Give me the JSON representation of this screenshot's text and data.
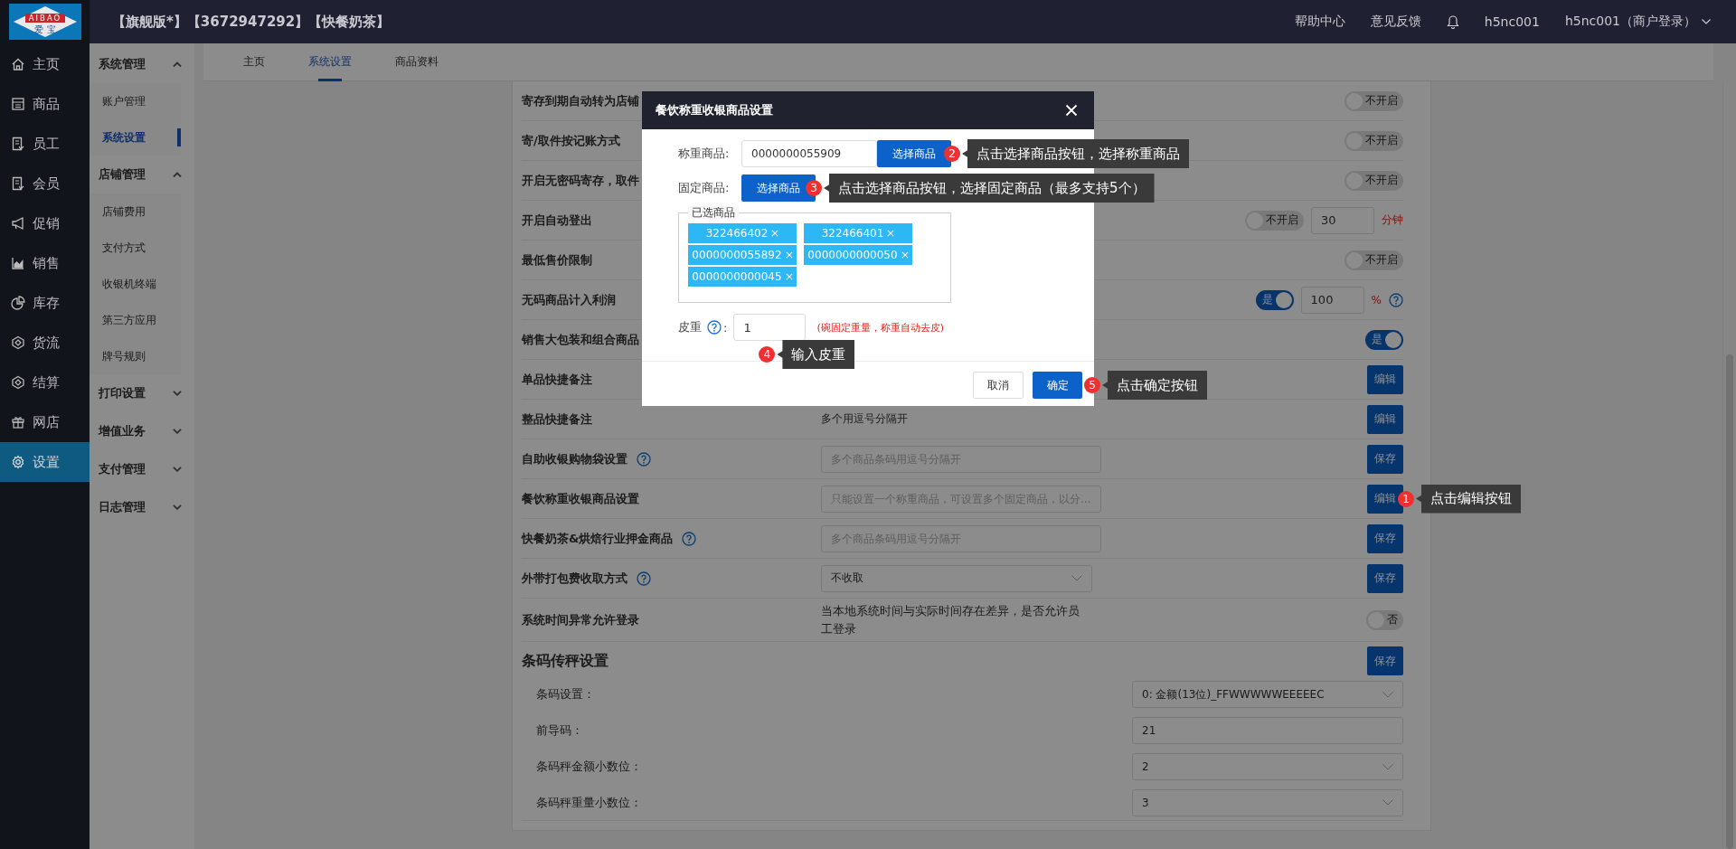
{
  "header": {
    "logo": {
      "text": "AIBAO",
      "subtext": "爱 宝"
    },
    "title": "【旗舰版*】【3672947292】【快餐奶茶】",
    "links": [
      "帮助中心",
      "意见反馈"
    ],
    "user": "h5nc001",
    "account": "h5nc001（商户登录）"
  },
  "nav": [
    {
      "label": "主页",
      "selected": false
    },
    {
      "label": "商品",
      "selected": false
    },
    {
      "label": "员工",
      "selected": false
    },
    {
      "label": "会员",
      "selected": false
    },
    {
      "label": "促销",
      "selected": false
    },
    {
      "label": "销售",
      "selected": false
    },
    {
      "label": "库存",
      "selected": false
    },
    {
      "label": "货流",
      "selected": false
    },
    {
      "label": "结算",
      "selected": false
    },
    {
      "label": "网店",
      "selected": false
    },
    {
      "label": "设置",
      "selected": true
    }
  ],
  "submenu": [
    {
      "label": "系统管理",
      "expanded": true,
      "children": [
        {
          "label": "账户管理",
          "selected": false
        },
        {
          "label": "系统设置",
          "selected": true
        }
      ]
    },
    {
      "label": "店铺管理",
      "expanded": true,
      "children": [
        {
          "label": "店铺费用",
          "selected": false
        },
        {
          "label": "支付方式",
          "selected": false
        },
        {
          "label": "收银机终端",
          "selected": false
        },
        {
          "label": "第三方应用",
          "selected": false
        },
        {
          "label": "牌号规则",
          "selected": false
        }
      ]
    },
    {
      "label": "打印设置",
      "expanded": false
    },
    {
      "label": "增值业务",
      "expanded": false
    },
    {
      "label": "支付管理",
      "expanded": false
    },
    {
      "label": "日志管理",
      "expanded": false
    }
  ],
  "tabs": [
    {
      "label": "主页",
      "selected": false
    },
    {
      "label": "系统设置",
      "selected": true
    },
    {
      "label": "商品资料",
      "selected": false
    }
  ],
  "settings": {
    "rows": [
      {
        "label": "寄存到期自动转为店铺",
        "kind": "toggle",
        "toggle": {
          "on": false,
          "text": "不开启"
        }
      },
      {
        "label": "寄/取件按记账方式",
        "kind": "toggle",
        "toggle": {
          "on": false,
          "text": "不开启"
        }
      },
      {
        "label": "开启无密码寄存，取件",
        "kind": "toggle",
        "toggle": {
          "on": false,
          "text": "不开启"
        }
      },
      {
        "label": "开启自动登出",
        "kind": "toggle_input",
        "toggle": {
          "on": false,
          "text": "不开启"
        },
        "value": "30",
        "unit": "分钟",
        "unit_help": false
      },
      {
        "label": "最低售价限制",
        "kind": "toggle",
        "toggle": {
          "on": false,
          "text": "不开启"
        }
      },
      {
        "label": "无码商品计入利润",
        "kind": "toggle_input",
        "toggle": {
          "on": true,
          "text": "是"
        },
        "value": "100",
        "unit": "%",
        "unit_help": true
      },
      {
        "label": "销售大包装和组合商品",
        "kind": "toggle",
        "toggle": {
          "on": true,
          "text": "是"
        }
      },
      {
        "label": "单品快捷备注",
        "kind": "button",
        "button": "编辑"
      },
      {
        "label": "整品快捷备注",
        "kind": "text_button",
        "text": "多个用逗号分隔开",
        "button": "编辑"
      },
      {
        "label": "自助收银购物袋设置",
        "help": true,
        "kind": "input_button",
        "placeholder": "多个商品条码用逗号分隔开",
        "button": "保存"
      },
      {
        "label": "餐饮称重收银商品设置",
        "kind": "input_button",
        "placeholder": "只能设置一个称重商品，可设置多个固定商品，以分...",
        "button": "编辑",
        "callout": {
          "number": "1",
          "text": "点击编辑按钮"
        }
      },
      {
        "label": "快餐奶茶&烘焙行业押金商品",
        "help": true,
        "kind": "input_button",
        "placeholder": "多个商品条码用逗号分隔开",
        "button": "保存"
      },
      {
        "label": "外带打包费收取方式",
        "help": true,
        "kind": "select_button",
        "value": "不收取",
        "button": "保存"
      },
      {
        "label": "系统时间异常允许登录",
        "kind": "text_toggle",
        "text": "当本地系统时间与实际时间存在差异，是否允许员工登录",
        "toggle": {
          "on": false,
          "text": "否"
        }
      }
    ],
    "section": {
      "title": "条码传秤设置",
      "button": "保存",
      "rows": [
        {
          "label": "条码设置：",
          "kind": "select",
          "value": "0: 金额(13位)_FFWWWWWEEEEEC"
        },
        {
          "label": "前导码：",
          "kind": "input",
          "value": "21"
        },
        {
          "label": "条码秤金额小数位：",
          "kind": "select",
          "value": "2"
        },
        {
          "label": "条码秤重量小数位：",
          "kind": "select",
          "value": "3"
        }
      ]
    }
  },
  "dialog": {
    "title": "餐饮称重收银商品设置",
    "weigh": {
      "label": "称重商品:",
      "value": "0000000055909",
      "button": "选择商品",
      "callout": {
        "number": "2",
        "text": "点击选择商品按钮，选择称重商品"
      }
    },
    "fixed": {
      "label": "固定商品:",
      "button": "选择商品",
      "callout": {
        "number": "3",
        "text": "点击选择商品按钮，选择固定商品（最多支持5个）"
      }
    },
    "selected": {
      "legend": "已选商品",
      "tags": [
        {
          "text": "322466402"
        },
        {
          "text": "322466401"
        },
        {
          "text": "0000000055892"
        },
        {
          "text": "0000000000050"
        },
        {
          "text": "0000000000045"
        }
      ]
    },
    "tare": {
      "label": "皮重",
      "suffix": ":",
      "value": "1",
      "hint": "(碗固定重量，称重自动去皮)",
      "callout": {
        "number": "4",
        "text": "输入皮重"
      }
    },
    "buttons": [
      {
        "label": "取消",
        "kind": "secondary"
      },
      {
        "label": "确定",
        "kind": "primary",
        "callout": {
          "number": "5",
          "text": "点击确定按钮"
        }
      }
    ]
  }
}
